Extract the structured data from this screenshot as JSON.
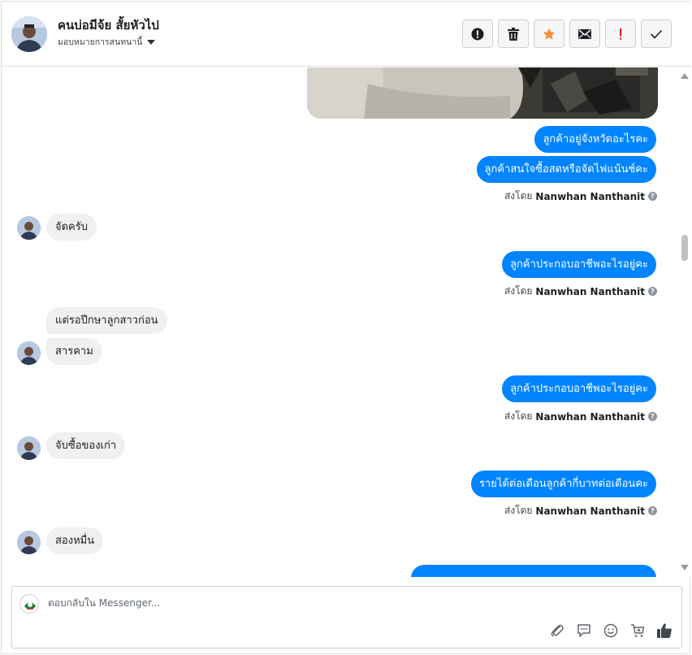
{
  "header": {
    "name": "คนบ่อมีจ้ย สั้ยหัวไป",
    "assign_label": "มอบหมายการสนทนานี้"
  },
  "toolbar": {
    "icons": [
      "alert-circle-icon",
      "trash-icon",
      "star-icon",
      "envelope-icon",
      "exclamation-icon",
      "check-icon"
    ],
    "accent_star": "#f7923a",
    "accent_exclaim": "#e02020"
  },
  "messages": [
    {
      "side": "out",
      "text": "ลูกค้าอยู่จังหวัดอะไรคะ"
    },
    {
      "side": "out",
      "text": "ลูกค้าสนใจซื้อสดหรือจัดไฟแน้นช์คะ"
    },
    {
      "side": "out",
      "text": "ลูกค้าประกอบอาชีพอะไรอยู่คะ"
    },
    {
      "side": "out",
      "text": "ลูกค้าประกอบอาชีพอะไรอยู่คะ"
    },
    {
      "side": "out",
      "text": "รายได้ต่อเดือนลูกค้ากี่บาทต่อเดือนคะ"
    },
    {
      "side": "in",
      "text": "จัดครับ"
    },
    {
      "side": "in",
      "text": "แต่รอปึกษาลูกสาวก่อน"
    },
    {
      "side": "in",
      "text": "สารคาม"
    },
    {
      "side": "in",
      "text": "จับซื้อของเก่า"
    },
    {
      "side": "in",
      "text": "สองหมื่น"
    }
  ],
  "sent_by": {
    "prefix": "ส่งโดย",
    "name": "Nanwhan Nanthanit",
    "help": "?"
  },
  "composer": {
    "placeholder": "ตอบกลับใน Messenger...",
    "tools": [
      "paperclip-icon",
      "chat-bubble-icon",
      "smiley-icon",
      "cart-plus-icon",
      "thumbs-up-icon"
    ]
  },
  "colors": {
    "outgoing_bubble": "#0084ff",
    "incoming_bubble": "#f1f0f0"
  }
}
